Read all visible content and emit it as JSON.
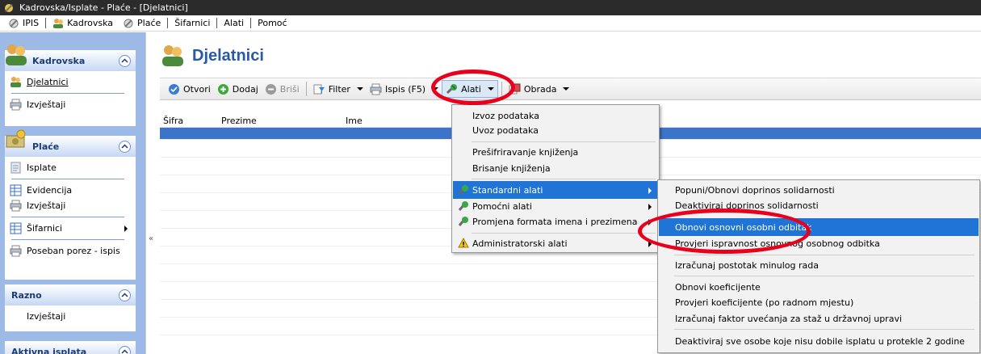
{
  "window": {
    "title": "Kadrovska/Isplate - Plaće - [Djelatnici]"
  },
  "menubar": {
    "items": [
      "IPIS",
      "Kadrovska",
      "Plaće",
      "Šifarnici",
      "Alati",
      "Pomoć"
    ]
  },
  "sidebar": {
    "groups": [
      {
        "title": "Kadrovska",
        "items": [
          "Djelatnici",
          "Izvještaji"
        ]
      },
      {
        "title": "Plaće",
        "items": [
          "Isplate",
          "Evidencija",
          "Izvještaji",
          "Šifarnici",
          "Poseban porez - ispis"
        ]
      },
      {
        "title": "Razno",
        "items": [
          "Izvještaji"
        ]
      },
      {
        "title": "Aktivna isplata"
      }
    ]
  },
  "page": {
    "title": "Djelatnici"
  },
  "toolbar": {
    "otvori": "Otvori",
    "dodaj": "Dodaj",
    "brisi": "Briši",
    "filter": "Filter",
    "ispis": "Ispis (F5)",
    "alati": "Alati",
    "obrada": "Obrada"
  },
  "grid": {
    "columns": [
      "Šifra",
      "Prezime",
      "Ime"
    ]
  },
  "alati_menu": {
    "items": [
      "Izvoz podataka",
      "Uvoz podataka",
      "Prešifriravanje knjiženja",
      "Brisanje knjiženja",
      "Standardni alati",
      "Pomoćni alati",
      "Promjena formata imena i prezimena",
      "Administratorski alati"
    ],
    "highlighted": "Standardni alati"
  },
  "standardni_submenu": {
    "items": [
      "Popuni/Obnovi doprinos solidarnosti",
      "Deaktiviraj doprinos solidarnosti",
      "Obnovi osnovni osobni odbitak",
      "Provjeri ispravnost osnovnog osobnog odbitka",
      "Izračunaj postotak minulog rada",
      "Obnovi koeficijente",
      "Provjeri koeficijente (po radnom mjestu)",
      "Izračunaj faktor uvećanja za staž u državnoj upravi",
      "Deaktiviraj sve osobe koje nisu dobile isplatu u protekle 2 godine"
    ],
    "highlighted": "Obnovi osnovni osobni odbitak"
  },
  "colors": {
    "highlight": "#1f74d6",
    "title_blue": "#2a5aa6",
    "sidebar_bg": "#9db9e6",
    "annotation": "#e8001c"
  }
}
